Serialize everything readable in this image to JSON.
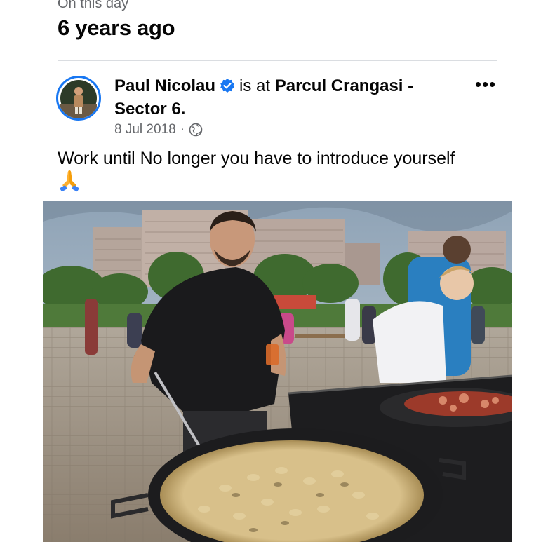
{
  "memories": {
    "section_label": "On this day",
    "years_ago": "6 years ago"
  },
  "post": {
    "author": "Paul Nicolau",
    "verified_icon": "verified-badge-icon",
    "is_at": "is at",
    "place": "Parcul Crangasi - Sector 6.",
    "date": "8 Jul 2018",
    "separator": "·",
    "privacy_icon": "globe-icon",
    "more_icon": "more-options-icon",
    "more_label": "•••",
    "caption": "Work until No longer you have to introduce yourself",
    "emoji_icon": "folded-hands-icon"
  },
  "colors": {
    "verified": "#1877f2",
    "secondary_text": "#65676b",
    "divider": "#dadde1"
  }
}
